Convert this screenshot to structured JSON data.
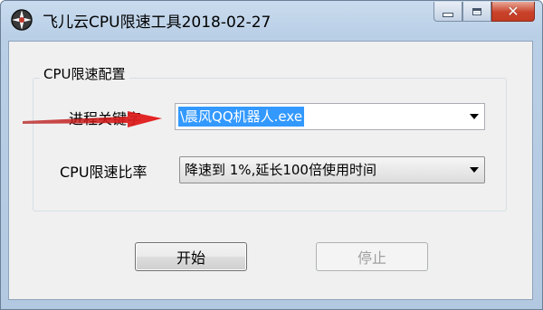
{
  "window": {
    "title": "飞儿云CPU限速工具2018-02-27",
    "icon": "app-gear-icon",
    "close_glyph": "✕"
  },
  "group": {
    "legend": "CPU限速配置"
  },
  "process": {
    "label": "进程关键字",
    "value": "\\晨风QQ机器人.exe"
  },
  "rate": {
    "label": "CPU限速比率",
    "value": "降速到 1%,延长100倍使用时间"
  },
  "buttons": {
    "start": "开始",
    "stop": "停止"
  },
  "annotation": {
    "arrow_color": "#e02020"
  }
}
